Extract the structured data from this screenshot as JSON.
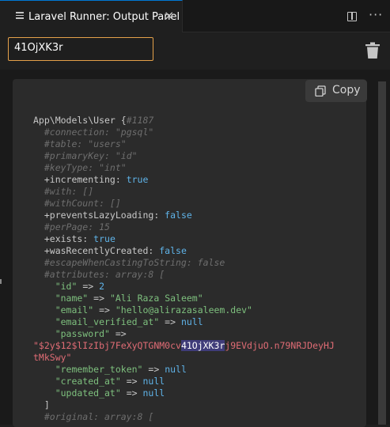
{
  "tab": {
    "title": "Laravel Runner: Output Panel",
    "close": "×"
  },
  "search": {
    "value": "41OjXK3r"
  },
  "copy": {
    "label": "Copy"
  },
  "code": {
    "l1a": "App\\Models\\User {",
    "l1b": "#1187",
    "l2": "  #connection: \"pgsql\"",
    "l3": "  #table: \"users\"",
    "l4": "  #primaryKey: \"id\"",
    "l5": "  #keyType: \"int\"",
    "l6a": "  +incrementing: ",
    "l6b": "true",
    "l7": "  #with: []",
    "l8": "  #withCount: []",
    "l9a": "  +preventsLazyLoading: ",
    "l9b": "false",
    "l10": "  #perPage: 15",
    "l11a": "  +exists: ",
    "l11b": "true",
    "l12a": "  +wasRecentlyCreated: ",
    "l12b": "false",
    "l13": "  #escapeWhenCastingToString: false",
    "l14": "  #attributes: array:8 [",
    "l15a": "    \"id\"",
    "l15b": " => ",
    "l15c": "2",
    "l16a": "    \"name\"",
    "l16b": " => ",
    "l16c": "\"Ali Raza Saleem\"",
    "l17a": "    \"email\"",
    "l17b": " => ",
    "l17c": "\"hello@alirazasaleem.dev\"",
    "l18a": "    \"email_verified_at\"",
    "l18b": " => ",
    "l18c": "null",
    "l19a": "    \"password\"",
    "l19b": " =>",
    "l20a": "\"$2y$12$lIzIbj7FeXyQTGNM0cv",
    "l20b": "41OjXK3r",
    "l20c": "j9EVdjuO.n79NRJDeyHJ",
    "l21": "tMkSwy\"",
    "l22a": "    \"remember_token\"",
    "l22b": " => ",
    "l22c": "null",
    "l23a": "    \"created_at\"",
    "l23b": " => ",
    "l23c": "null",
    "l24a": "    \"updated_at\"",
    "l24b": " => ",
    "l24c": "null",
    "l25": "  ]",
    "l26": "  #original: array:8 ["
  }
}
